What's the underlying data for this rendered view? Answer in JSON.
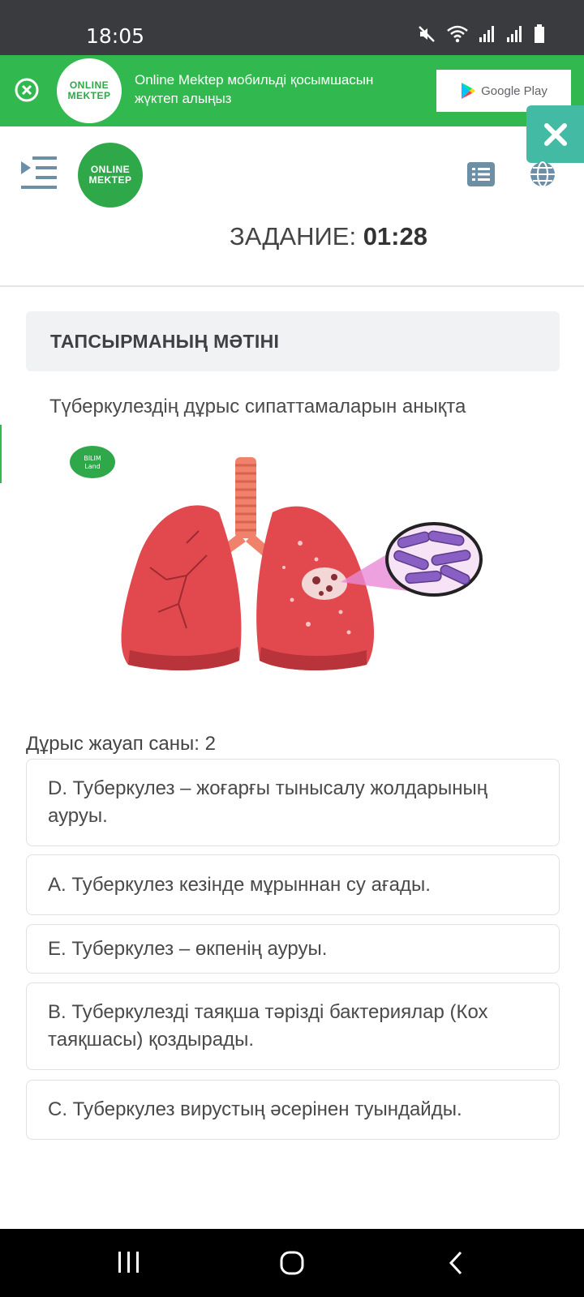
{
  "status_bar": {
    "time": "18:05"
  },
  "banner": {
    "logo_line1": "ONLINE",
    "logo_line2": "MEKTEP",
    "text": "Online Mektep мобильді қосымшасын жүктеп алыңыз",
    "google_play": "Google Play"
  },
  "header": {
    "logo_line1": "ONLINE",
    "logo_line2": "MEKTEP",
    "timer_label": "ЗАДАНИЕ:",
    "timer_value": "01:28"
  },
  "task": {
    "heading": "ТАПСЫРМАНЫҢ МӘТІНІ",
    "text": "Түберкулездің дұрыс сипаттамаларын анықта",
    "image_badge_line1": "BILIM",
    "image_badge_line2": "Land"
  },
  "answers_count": "Дұрыс жауап саны: 2",
  "options": [
    {
      "text": "D. Туберкулез – жоғарғы тынысалу жолдарының ауруы."
    },
    {
      "text": "А. Туберкулез кезінде мұрыннан су ағады."
    },
    {
      "text": "E. Туберкулез – өкпенің ауруы."
    },
    {
      "text": "B. Туберкулезді таяқша тәрізді бактериялар (Кох таяқшасы) қоздырады."
    },
    {
      "text": "C. Туберкулез вирустың әсерінен туындайды."
    }
  ],
  "colors": {
    "banner_green": "#31b84f",
    "float_close_teal": "#43bba4",
    "lung_red": "#e2494f",
    "bacteria_purple": "#8a5fc4"
  }
}
